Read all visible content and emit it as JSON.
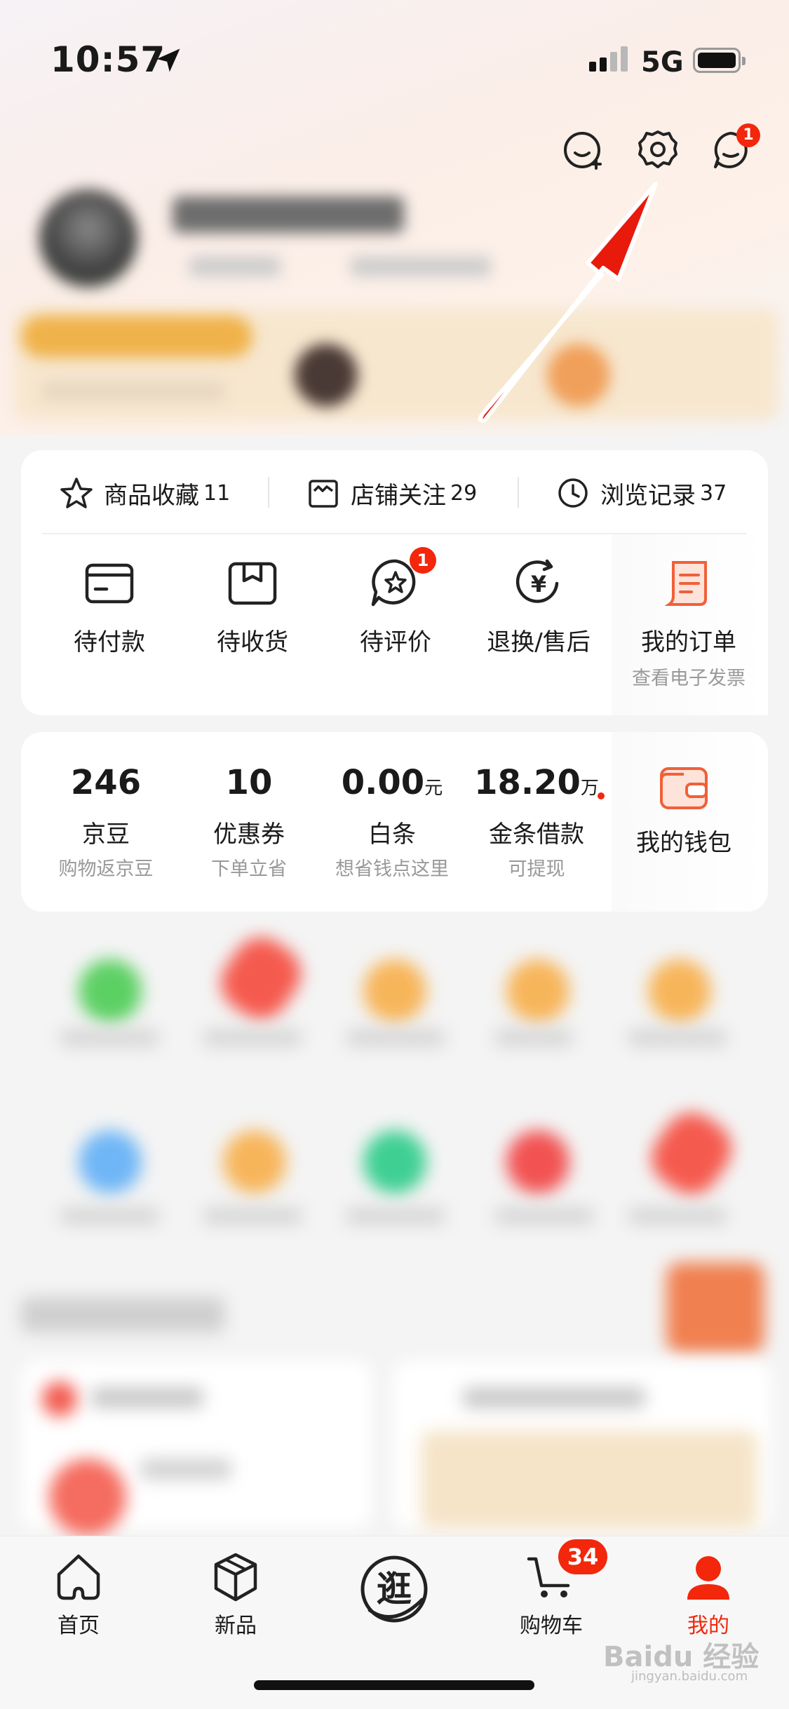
{
  "status": {
    "time": "10:57",
    "network": "5G"
  },
  "header": {
    "message_badge": "1"
  },
  "shortcuts": [
    {
      "label": "商品收藏",
      "count": "11"
    },
    {
      "label": "店铺关注",
      "count": "29"
    },
    {
      "label": "浏览记录",
      "count": "37"
    }
  ],
  "orders": [
    {
      "label": "待付款"
    },
    {
      "label": "待收货"
    },
    {
      "label": "待评价",
      "badge": "1"
    },
    {
      "label": "退换/售后"
    },
    {
      "label": "我的订单",
      "sub": "查看电子发票"
    }
  ],
  "assets": [
    {
      "value": "246",
      "unit": "",
      "name": "京豆",
      "hint": "购物返京豆"
    },
    {
      "value": "10",
      "unit": "",
      "name": "优惠券",
      "hint": "下单立省"
    },
    {
      "value": "0.00",
      "unit": "元",
      "name": "白条",
      "hint": "想省钱点这里"
    },
    {
      "value": "18.20",
      "unit": "万",
      "name": "金条借款",
      "hint": "可提现"
    }
  ],
  "wallet": {
    "label": "我的钱包"
  },
  "nav": {
    "items": [
      {
        "label": "首页"
      },
      {
        "label": "新品"
      },
      {
        "label": "逛"
      },
      {
        "label": "购物车",
        "badge": "34"
      },
      {
        "label": "我的"
      }
    ]
  },
  "watermark": {
    "brand": "Baidu 经验",
    "url": "jingyan.baidu.com"
  },
  "colors": {
    "accent": "#f2270c",
    "orange": "#f0603a"
  }
}
